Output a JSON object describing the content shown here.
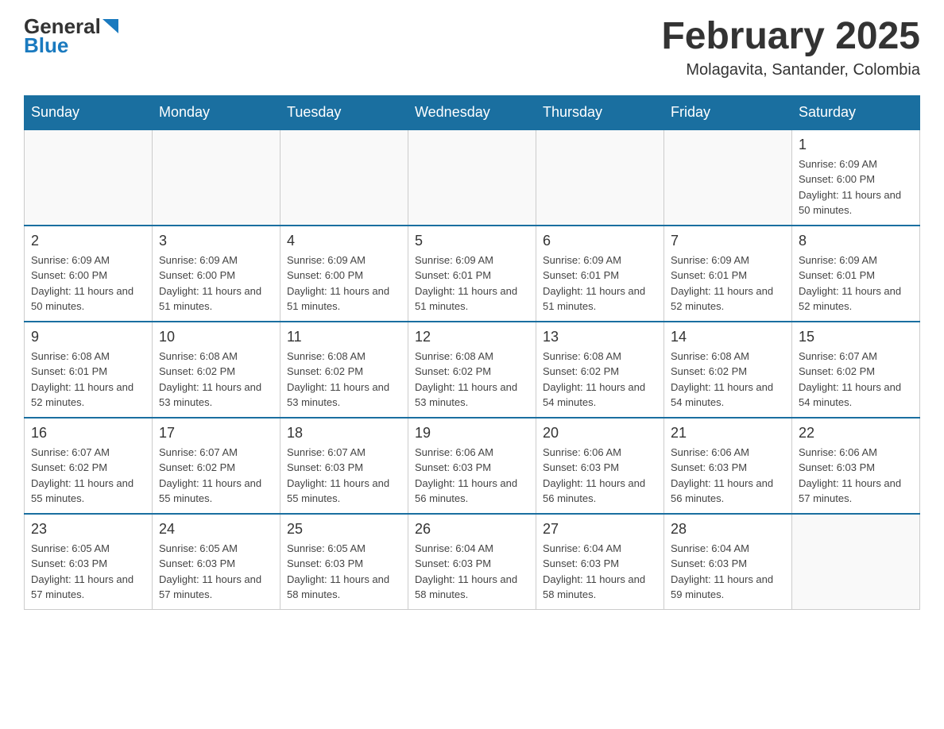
{
  "header": {
    "logo_general": "General",
    "logo_blue": "Blue",
    "title": "February 2025",
    "subtitle": "Molagavita, Santander, Colombia"
  },
  "days_of_week": [
    "Sunday",
    "Monday",
    "Tuesday",
    "Wednesday",
    "Thursday",
    "Friday",
    "Saturday"
  ],
  "weeks": [
    [
      {
        "day": "",
        "info": ""
      },
      {
        "day": "",
        "info": ""
      },
      {
        "day": "",
        "info": ""
      },
      {
        "day": "",
        "info": ""
      },
      {
        "day": "",
        "info": ""
      },
      {
        "day": "",
        "info": ""
      },
      {
        "day": "1",
        "info": "Sunrise: 6:09 AM\nSunset: 6:00 PM\nDaylight: 11 hours\nand 50 minutes."
      }
    ],
    [
      {
        "day": "2",
        "info": "Sunrise: 6:09 AM\nSunset: 6:00 PM\nDaylight: 11 hours\nand 50 minutes."
      },
      {
        "day": "3",
        "info": "Sunrise: 6:09 AM\nSunset: 6:00 PM\nDaylight: 11 hours\nand 51 minutes."
      },
      {
        "day": "4",
        "info": "Sunrise: 6:09 AM\nSunset: 6:00 PM\nDaylight: 11 hours\nand 51 minutes."
      },
      {
        "day": "5",
        "info": "Sunrise: 6:09 AM\nSunset: 6:01 PM\nDaylight: 11 hours\nand 51 minutes."
      },
      {
        "day": "6",
        "info": "Sunrise: 6:09 AM\nSunset: 6:01 PM\nDaylight: 11 hours\nand 51 minutes."
      },
      {
        "day": "7",
        "info": "Sunrise: 6:09 AM\nSunset: 6:01 PM\nDaylight: 11 hours\nand 52 minutes."
      },
      {
        "day": "8",
        "info": "Sunrise: 6:09 AM\nSunset: 6:01 PM\nDaylight: 11 hours\nand 52 minutes."
      }
    ],
    [
      {
        "day": "9",
        "info": "Sunrise: 6:08 AM\nSunset: 6:01 PM\nDaylight: 11 hours\nand 52 minutes."
      },
      {
        "day": "10",
        "info": "Sunrise: 6:08 AM\nSunset: 6:02 PM\nDaylight: 11 hours\nand 53 minutes."
      },
      {
        "day": "11",
        "info": "Sunrise: 6:08 AM\nSunset: 6:02 PM\nDaylight: 11 hours\nand 53 minutes."
      },
      {
        "day": "12",
        "info": "Sunrise: 6:08 AM\nSunset: 6:02 PM\nDaylight: 11 hours\nand 53 minutes."
      },
      {
        "day": "13",
        "info": "Sunrise: 6:08 AM\nSunset: 6:02 PM\nDaylight: 11 hours\nand 54 minutes."
      },
      {
        "day": "14",
        "info": "Sunrise: 6:08 AM\nSunset: 6:02 PM\nDaylight: 11 hours\nand 54 minutes."
      },
      {
        "day": "15",
        "info": "Sunrise: 6:07 AM\nSunset: 6:02 PM\nDaylight: 11 hours\nand 54 minutes."
      }
    ],
    [
      {
        "day": "16",
        "info": "Sunrise: 6:07 AM\nSunset: 6:02 PM\nDaylight: 11 hours\nand 55 minutes."
      },
      {
        "day": "17",
        "info": "Sunrise: 6:07 AM\nSunset: 6:02 PM\nDaylight: 11 hours\nand 55 minutes."
      },
      {
        "day": "18",
        "info": "Sunrise: 6:07 AM\nSunset: 6:03 PM\nDaylight: 11 hours\nand 55 minutes."
      },
      {
        "day": "19",
        "info": "Sunrise: 6:06 AM\nSunset: 6:03 PM\nDaylight: 11 hours\nand 56 minutes."
      },
      {
        "day": "20",
        "info": "Sunrise: 6:06 AM\nSunset: 6:03 PM\nDaylight: 11 hours\nand 56 minutes."
      },
      {
        "day": "21",
        "info": "Sunrise: 6:06 AM\nSunset: 6:03 PM\nDaylight: 11 hours\nand 56 minutes."
      },
      {
        "day": "22",
        "info": "Sunrise: 6:06 AM\nSunset: 6:03 PM\nDaylight: 11 hours\nand 57 minutes."
      }
    ],
    [
      {
        "day": "23",
        "info": "Sunrise: 6:05 AM\nSunset: 6:03 PM\nDaylight: 11 hours\nand 57 minutes."
      },
      {
        "day": "24",
        "info": "Sunrise: 6:05 AM\nSunset: 6:03 PM\nDaylight: 11 hours\nand 57 minutes."
      },
      {
        "day": "25",
        "info": "Sunrise: 6:05 AM\nSunset: 6:03 PM\nDaylight: 11 hours\nand 58 minutes."
      },
      {
        "day": "26",
        "info": "Sunrise: 6:04 AM\nSunset: 6:03 PM\nDaylight: 11 hours\nand 58 minutes."
      },
      {
        "day": "27",
        "info": "Sunrise: 6:04 AM\nSunset: 6:03 PM\nDaylight: 11 hours\nand 58 minutes."
      },
      {
        "day": "28",
        "info": "Sunrise: 6:04 AM\nSunset: 6:03 PM\nDaylight: 11 hours\nand 59 minutes."
      },
      {
        "day": "",
        "info": ""
      }
    ]
  ]
}
